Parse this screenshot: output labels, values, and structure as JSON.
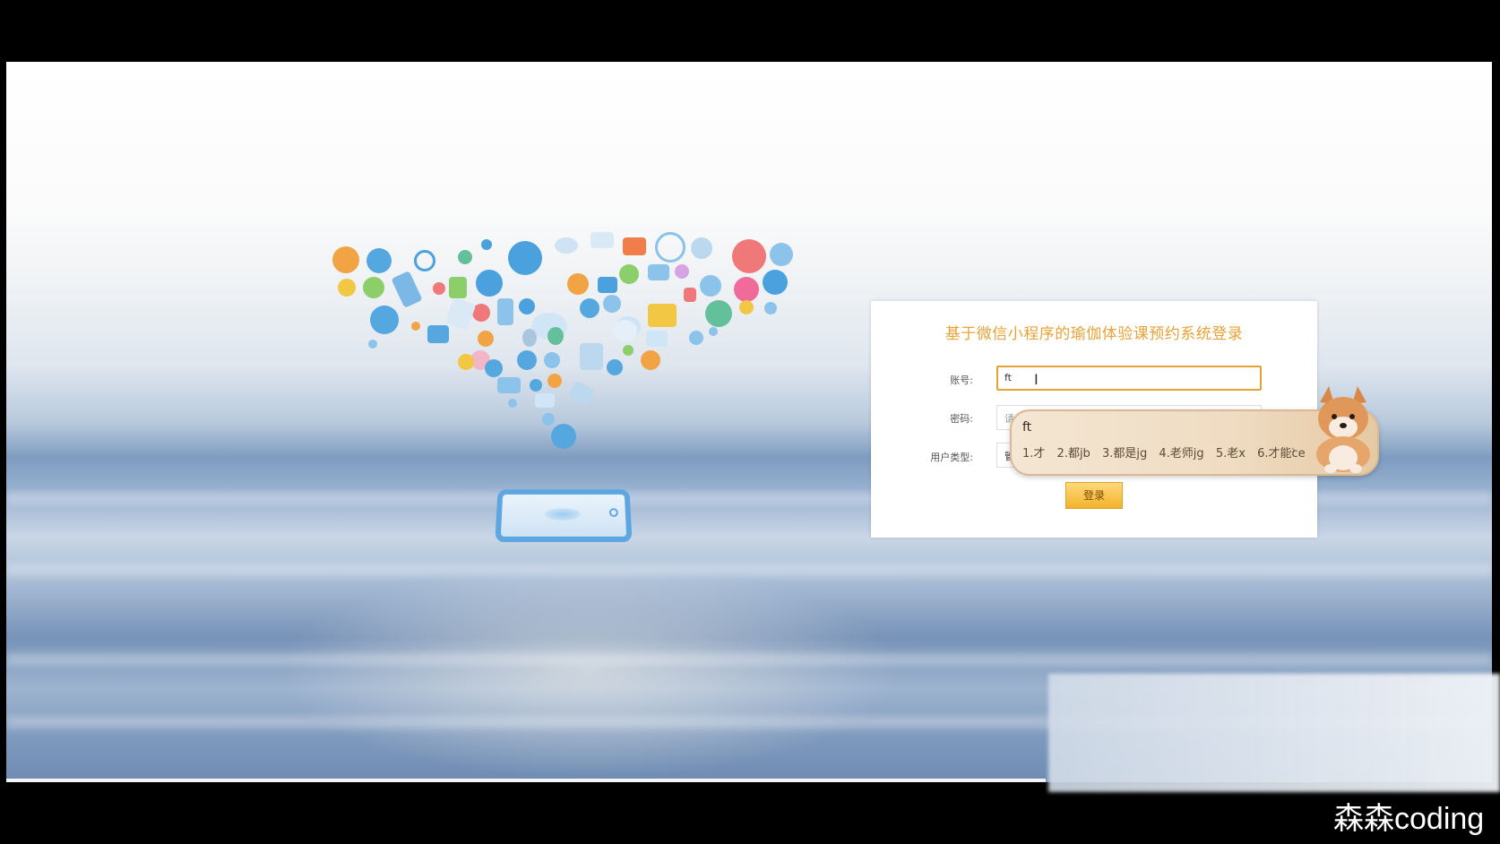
{
  "login": {
    "title": "基于微信小程序的瑜伽体验课预约系统登录",
    "account_label": "账号:",
    "account_value": "ft",
    "password_label": "密码:",
    "password_placeholder_visible": "请",
    "user_type_label": "用户类型:",
    "user_type_value_visible": "管",
    "submit_label": "登录"
  },
  "ime": {
    "composition": "ft",
    "candidates": [
      "1.才",
      "2.都jb",
      "3.都是jg",
      "4.老师jg",
      "5.老x",
      "6.才能ce"
    ],
    "next_arrow": "›"
  },
  "watermark": "森森coding",
  "colors": {
    "accent_orange": "#e8a236",
    "button_top": "#ffd97a",
    "button_bottom": "#f3b22c",
    "tablet_blue": "#5ea6e2"
  }
}
